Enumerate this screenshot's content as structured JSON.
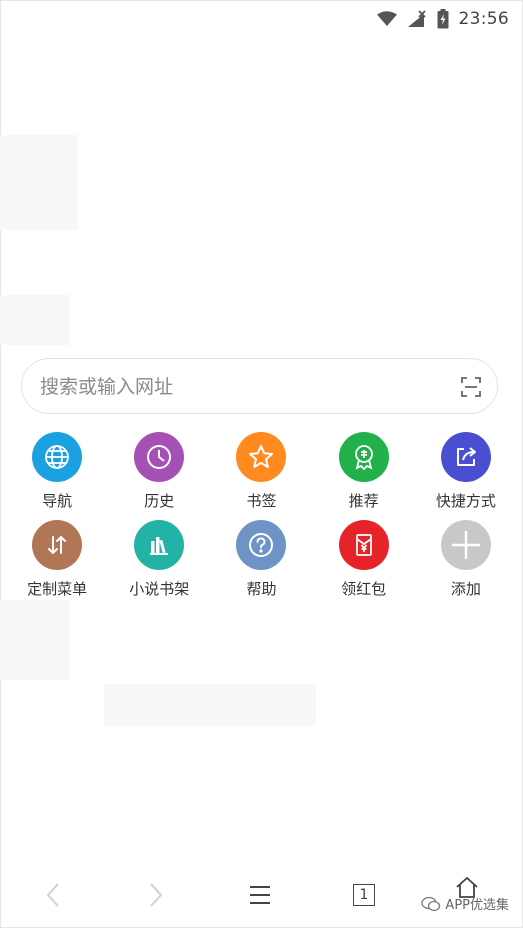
{
  "status_bar": {
    "time": "23:56"
  },
  "search": {
    "placeholder": "搜索或输入网址"
  },
  "shortcuts": [
    {
      "label": "导航",
      "color": "#1BA1E2",
      "icon": "globe-icon"
    },
    {
      "label": "历史",
      "color": "#A550B5",
      "icon": "clock-icon"
    },
    {
      "label": "书签",
      "color": "#FF8A1F",
      "icon": "star-icon"
    },
    {
      "label": "推荐",
      "color": "#22B04B",
      "icon": "recommend-badge-icon"
    },
    {
      "label": "快捷方式",
      "color": "#4A4FD1",
      "icon": "share-shortcut-icon"
    },
    {
      "label": "定制菜单",
      "color": "#B07655",
      "icon": "sort-arrows-icon"
    },
    {
      "label": "小说书架",
      "color": "#22B3A6",
      "icon": "books-icon"
    },
    {
      "label": "帮助",
      "color": "#6E93C6",
      "icon": "help-icon"
    },
    {
      "label": "领红包",
      "color": "#E7232A",
      "icon": "red-packet-icon"
    },
    {
      "label": "添加",
      "color": "#C8C8C8",
      "icon": "plus-icon"
    }
  ],
  "bottom_nav": {
    "tab_count": "1"
  },
  "watermark": {
    "text": "APP优选集"
  }
}
